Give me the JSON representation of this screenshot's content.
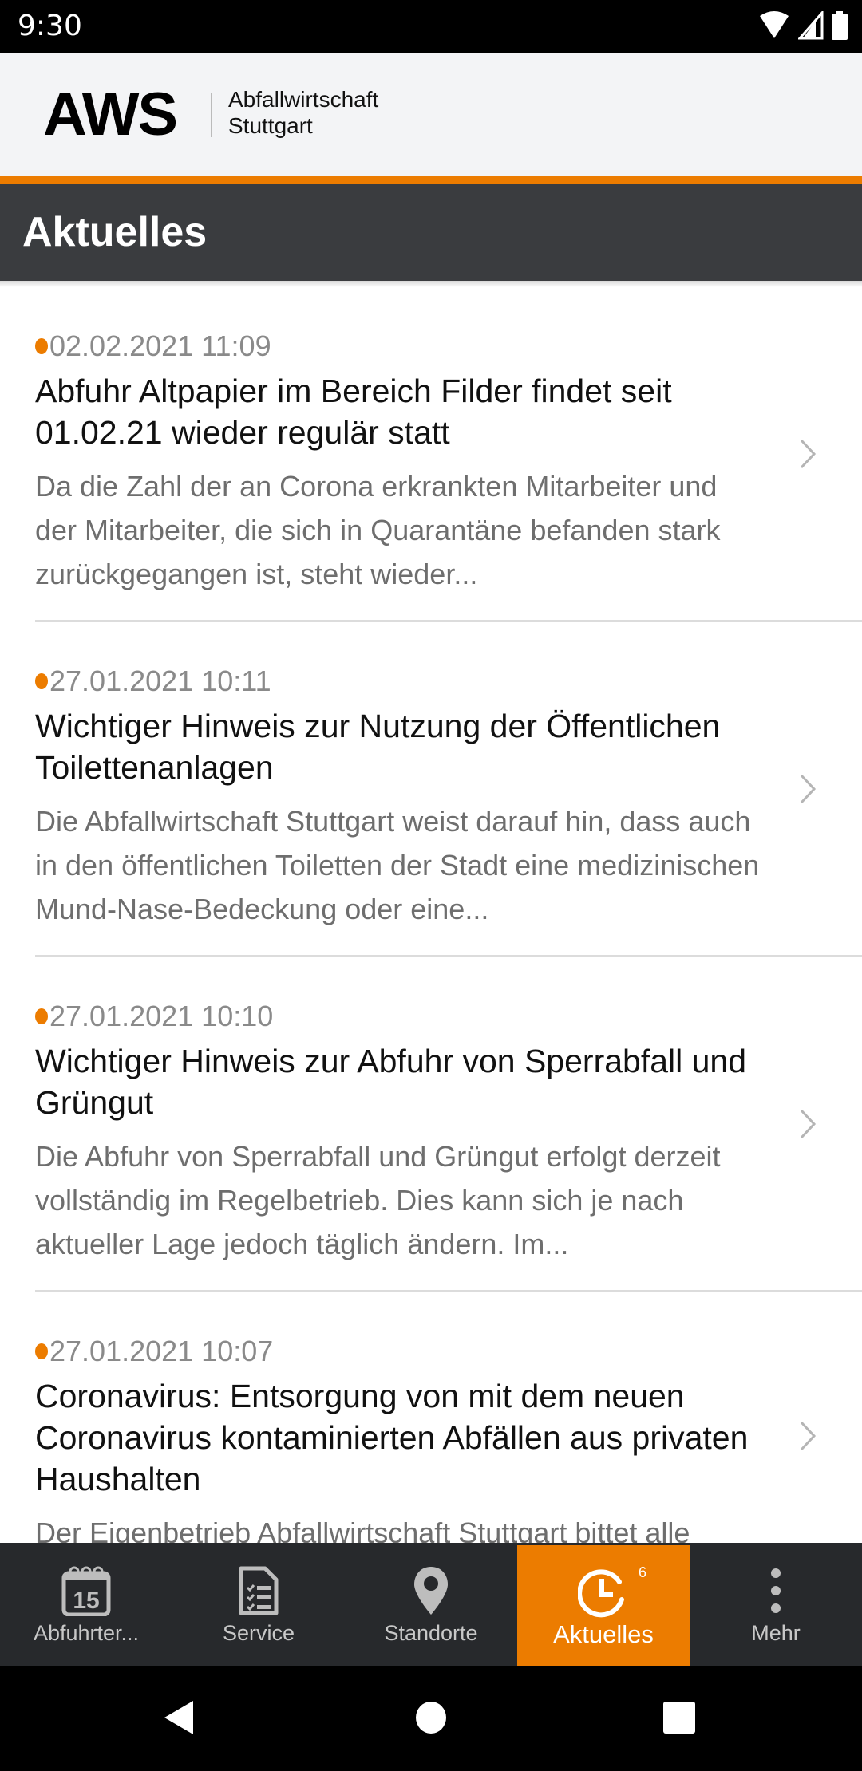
{
  "status_bar": {
    "time": "9:30"
  },
  "brand": {
    "logo": "AWS",
    "line1": "Abfallwirtschaft",
    "line2": "Stuttgart"
  },
  "page": {
    "title": "Aktuelles"
  },
  "colors": {
    "accent": "#ec7c00",
    "header_dark": "#3a3c3f",
    "tabbar": "#27292c"
  },
  "news": [
    {
      "date": "02.02.2021 11:09",
      "title": "Abfuhr Altpapier im Bereich Filder findet seit 01.02.21 wieder regulär statt",
      "teaser": "Da die Zahl der an Corona erkrankten Mitarbeiter und der Mitarbeiter, die sich in Quarantäne befanden stark zurückgegangen ist, steht wieder..."
    },
    {
      "date": "27.01.2021 10:11",
      "title": "Wichtiger Hinweis zur Nutzung der Öffentlichen Toilettenanlagen",
      "teaser": "Die Abfallwirtschaft Stuttgart weist darauf hin, dass auch in den öffentlichen Toiletten der Stadt eine medizinischen Mund-Nase-Bedeckung oder eine..."
    },
    {
      "date": "27.01.2021 10:10",
      "title": "Wichtiger Hinweis zur Abfuhr von Sperrabfall und Grüngut",
      "teaser": "Die Abfuhr von Sperrabfall und Grüngut erfolgt derzeit vollständig im Regelbetrieb. Dies kann sich je nach aktueller Lage jedoch täglich ändern. Im..."
    },
    {
      "date": "27.01.2021 10:07",
      "title": "Coronavirus: Entsorgung von mit dem neuen Coronavirus kontaminierten Abfällen aus privaten Haushalten",
      "teaser": "Der Eigenbetrieb Abfallwirtschaft Stuttgart bittet alle"
    }
  ],
  "tabs": [
    {
      "label": "Abfuhrter...",
      "icon": "calendar-icon",
      "icon_text": "15",
      "active": false
    },
    {
      "label": "Service",
      "icon": "checklist-icon",
      "active": false
    },
    {
      "label": "Standorte",
      "icon": "location-pin-icon",
      "active": false
    },
    {
      "label": "Aktuelles",
      "icon": "clock-icon",
      "badge": "6",
      "active": true
    },
    {
      "label": "Mehr",
      "icon": "more-vertical-icon",
      "active": false
    }
  ]
}
